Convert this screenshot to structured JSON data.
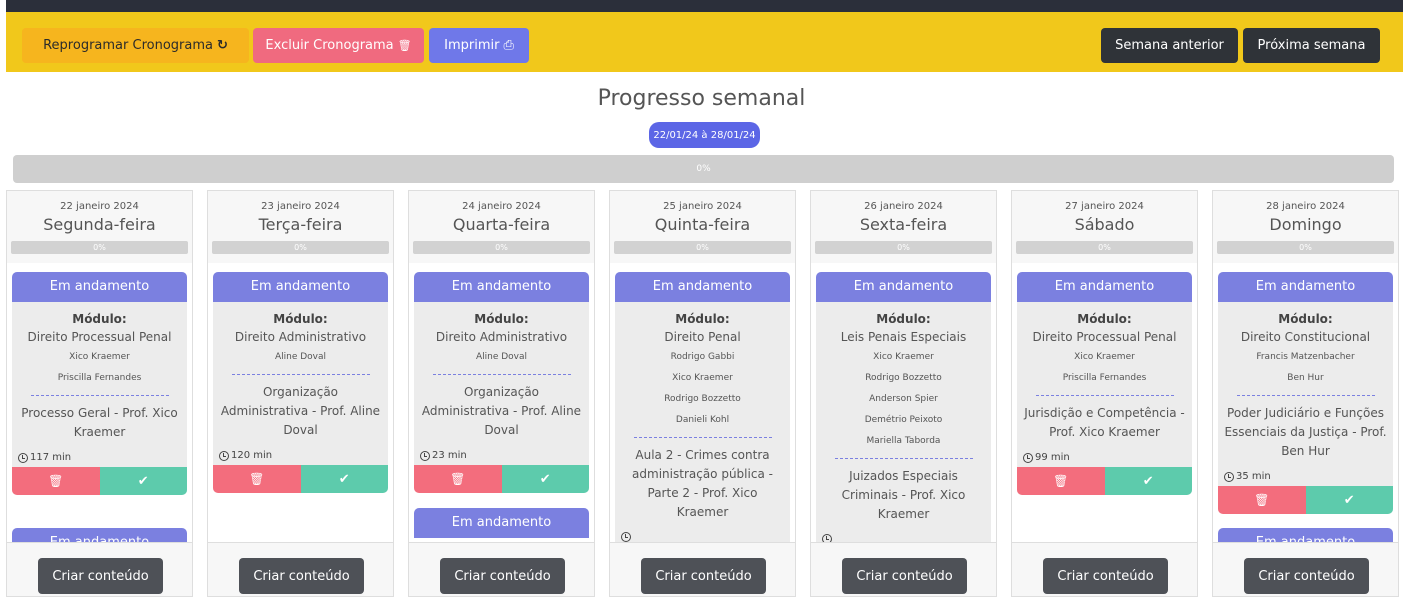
{
  "toolbar": {
    "reprogramar_label": "Reprogramar Cronograma",
    "excluir_label": "Excluir Cronograma",
    "imprimir_label": "Imprimir",
    "prev_week_label": "Semana anterior",
    "next_week_label": "Próxima semana"
  },
  "icons": {
    "refresh": "↻",
    "trash": "🗑",
    "print": "⎙",
    "check": "✔"
  },
  "header": {
    "title": "Progresso semanal",
    "date_range": "22/01/24 à 28/01/24",
    "week_progress_label": "0%",
    "week_progress_value": 0
  },
  "colors": {
    "topbar": "#f1c81b",
    "accent": "#5c66e6",
    "card_header": "#7b80e0",
    "delete": "#f36d7d",
    "confirm": "#5dcbac"
  },
  "days": [
    {
      "date": "22 janeiro 2024",
      "weekday": "Segunda-feira",
      "progress": "0%",
      "card": {
        "status": "Em andamento",
        "module_label": "Módulo:",
        "module": "Direito Processual Penal",
        "professors": [
          "Xico Kraemer",
          "Priscilla Fernandes"
        ],
        "lesson": "Processo Geral - Prof. Xico Kraemer",
        "duration": "117 min",
        "has_actions": true
      },
      "next_status": "Em andamento",
      "create_label": "Criar conteúdo"
    },
    {
      "date": "23 janeiro 2024",
      "weekday": "Terça-feira",
      "progress": "0%",
      "card": {
        "status": "Em andamento",
        "module_label": "Módulo:",
        "module": "Direito Administrativo",
        "professors": [
          "Aline Doval"
        ],
        "lesson": "Organização Administrativa - Prof. Aline Doval",
        "duration": "120 min",
        "has_actions": true
      },
      "next_status": "",
      "create_label": "Criar conteúdo"
    },
    {
      "date": "24 janeiro 2024",
      "weekday": "Quarta-feira",
      "progress": "0%",
      "card": {
        "status": "Em andamento",
        "module_label": "Módulo:",
        "module": "Direito Administrativo",
        "professors": [
          "Aline Doval"
        ],
        "lesson": "Organização Administrativa - Prof. Aline Doval",
        "duration": "23 min",
        "has_actions": true
      },
      "next_status": "Em andamento",
      "create_label": "Criar conteúdo"
    },
    {
      "date": "25 janeiro 2024",
      "weekday": "Quinta-feira",
      "progress": "0%",
      "card": {
        "status": "Em andamento",
        "module_label": "Módulo:",
        "module": "Direito Penal",
        "professors": [
          "Rodrigo Gabbi",
          "Xico Kraemer",
          "Rodrigo Bozzetto",
          "Danieli Kohl"
        ],
        "lesson": "Aula 2 - Crimes contra administração pública - Parte 2 - Prof. Xico Kraemer",
        "duration": "",
        "has_actions": false
      },
      "next_status": "",
      "create_label": "Criar conteúdo"
    },
    {
      "date": "26 janeiro 2024",
      "weekday": "Sexta-feira",
      "progress": "0%",
      "card": {
        "status": "Em andamento",
        "module_label": "Módulo:",
        "module": "Leis Penais Especiais",
        "professors": [
          "Xico Kraemer",
          "Rodrigo Bozzetto",
          "Anderson Spier",
          "Demétrio Peixoto",
          "Mariella Taborda"
        ],
        "lesson": "Juizados Especiais Criminais - Prof. Xico Kraemer",
        "duration": "",
        "has_actions": false
      },
      "next_status": "",
      "create_label": "Criar conteúdo"
    },
    {
      "date": "27 janeiro 2024",
      "weekday": "Sábado",
      "progress": "0%",
      "card": {
        "status": "Em andamento",
        "module_label": "Módulo:",
        "module": "Direito Processual Penal",
        "professors": [
          "Xico Kraemer",
          "Priscilla Fernandes"
        ],
        "lesson": "Jurisdição e Competência - Prof. Xico Kraemer",
        "duration": "99 min",
        "has_actions": true
      },
      "next_status": "",
      "create_label": "Criar conteúdo"
    },
    {
      "date": "28 janeiro 2024",
      "weekday": "Domingo",
      "progress": "0%",
      "card": {
        "status": "Em andamento",
        "module_label": "Módulo:",
        "module": "Direito Constitucional",
        "professors": [
          "Francis Matzenbacher",
          "Ben Hur"
        ],
        "lesson": "Poder Judiciário e Funções Essenciais da Justiça - Prof. Ben Hur",
        "duration": "35 min",
        "has_actions": true
      },
      "next_status": "Em andamento",
      "create_label": "Criar conteúdo"
    }
  ]
}
